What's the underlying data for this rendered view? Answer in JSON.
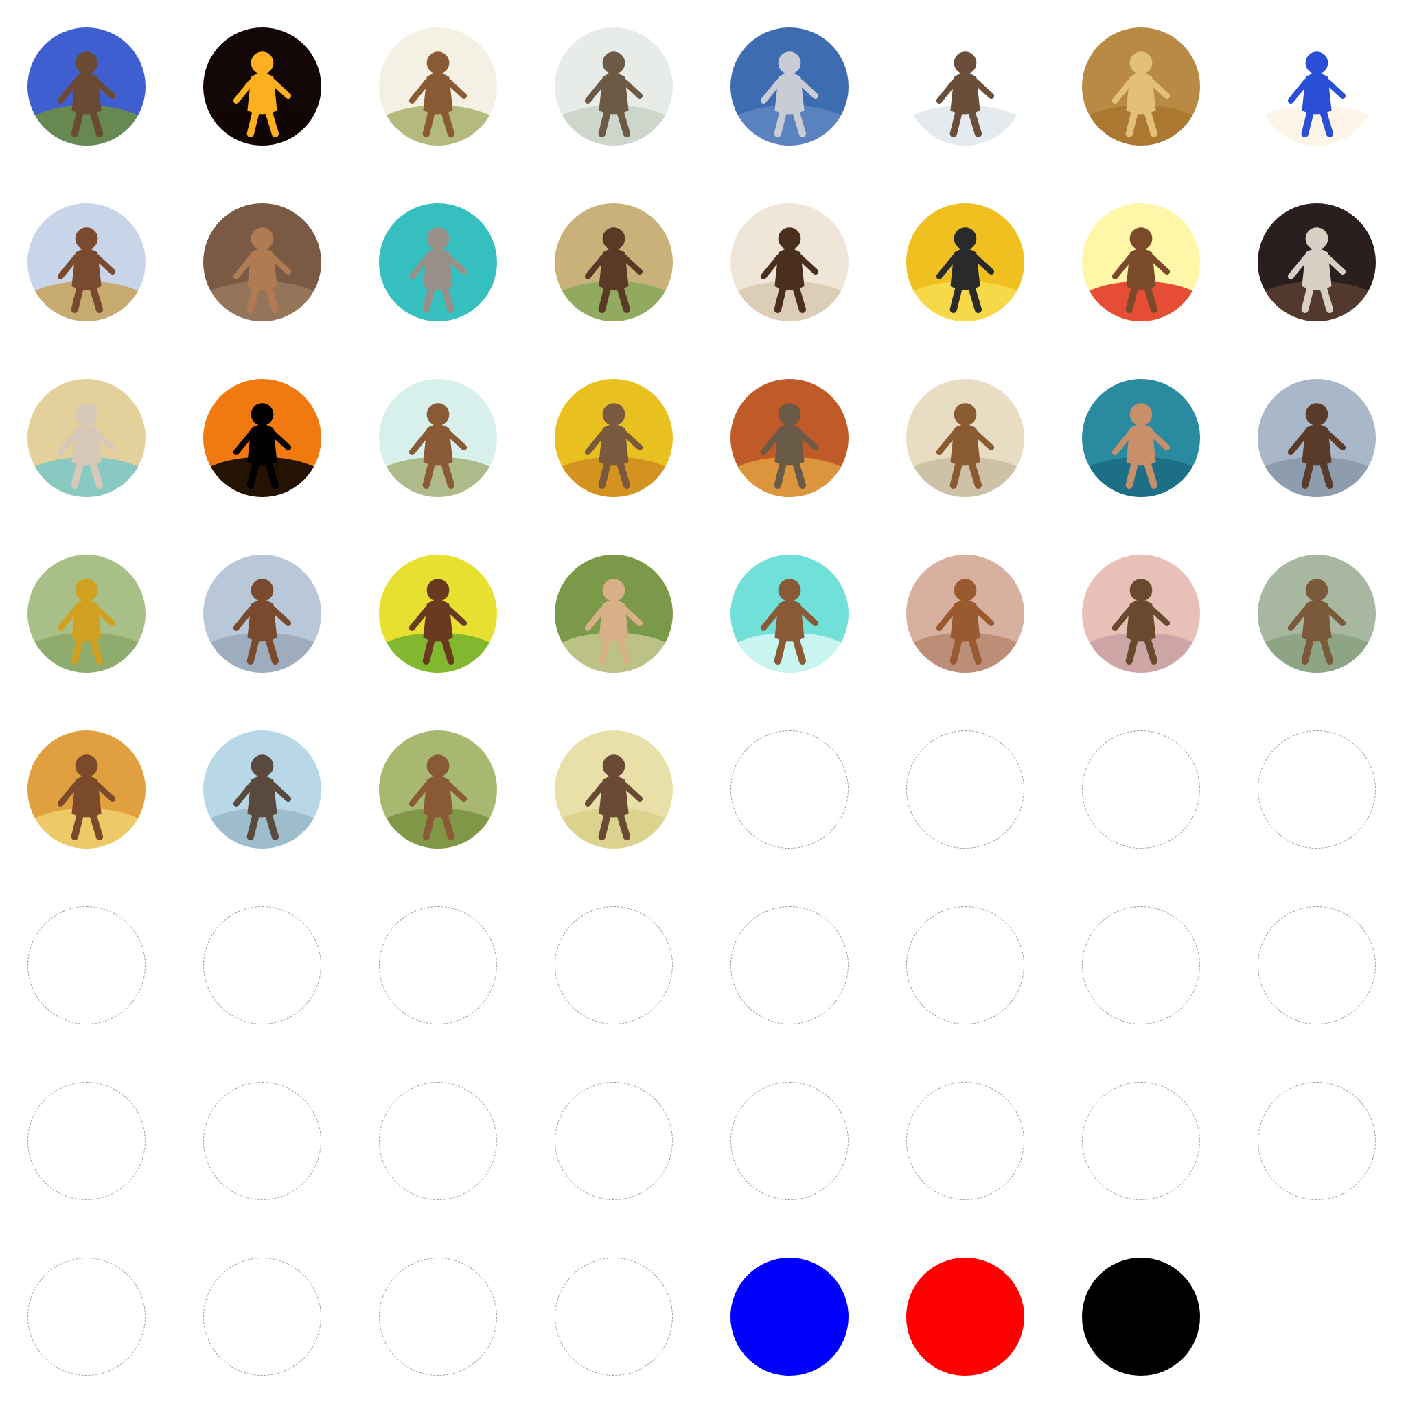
{
  "sprite_sheet": {
    "columns": 8,
    "rows": 8,
    "background": "#ffffff",
    "empty_outline_color": "#9a9a9a",
    "tokens": [
      {
        "icon": "caveman-crouching-icon",
        "bg": "#3f5fd0",
        "ground": "#6f8f3a",
        "figure": "#6b4a33"
      },
      {
        "icon": "torch-fire-icon",
        "bg": "#120606",
        "ground": "#120606",
        "figure": "#ffb020"
      },
      {
        "icon": "cavemen-with-clubs-icon",
        "bg": "#f4f1e4",
        "ground": "#a8b06a",
        "figure": "#8a5a35"
      },
      {
        "icon": "hunters-with-horse-icon",
        "bg": "#e8ece8",
        "ground": "#c9d2c6",
        "figure": "#6d5a45"
      },
      {
        "icon": "bearded-elder-with-staff-icon",
        "bg": "#3d6cb0",
        "ground": "#5f86c2",
        "figure": "#c9ccd4"
      },
      {
        "icon": "spear-thrower-icon",
        "bg": "#ffffff",
        "ground": "#dfe6ea",
        "figure": "#6b4e3a"
      },
      {
        "icon": "desert-scene-icon",
        "bg": "#b98a44",
        "ground": "#a8742f",
        "figure": "#e3c07a"
      },
      {
        "icon": "archer-in-blue-icon",
        "bg": "#ffffff",
        "ground": "#fdf3e4",
        "figure": "#2a4fd6"
      },
      {
        "icon": "hunter-with-bow-icon",
        "bg": "#c8d4e8",
        "ground": "#c6a25a",
        "figure": "#7a4a2f"
      },
      {
        "icon": "seated-caveman-icon",
        "bg": "#7a5a45",
        "ground": "#9a7a5e",
        "figure": "#b07a52"
      },
      {
        "icon": "meditating-sage-icon",
        "bg": "#36bfbf",
        "ground": "#36bfbf",
        "figure": "#9a8f88"
      },
      {
        "icon": "hominid-profile-icon",
        "bg": "#c8b27a",
        "ground": "#88a85a",
        "figure": "#5a3a26"
      },
      {
        "icon": "hairy-caveman-with-spear-icon",
        "bg": "#efe6d8",
        "ground": "#d8c8b0",
        "figure": "#4a2e1e"
      },
      {
        "icon": "walking-chimp-icon",
        "bg": "#f0c020",
        "ground": "#f6dd50",
        "figure": "#2a2a2a"
      },
      {
        "icon": "upright-hominid-rays-icon",
        "bg": "#fff6a8",
        "ground": "#e03020",
        "figure": "#7a4a2a"
      },
      {
        "icon": "bearded-man-dark-icon",
        "bg": "#2a1e1e",
        "ground": "#5a3e30",
        "figure": "#d8d0c4"
      },
      {
        "icon": "painted-face-woman-icon",
        "bg": "#e4d09a",
        "ground": "#7ac8c8",
        "figure": "#d8c8b8"
      },
      {
        "icon": "silhouette-fire-orb-icon",
        "bg": "#f07a10",
        "ground": "#000000",
        "figure": "#000000"
      },
      {
        "icon": "fur-clad-hunter-icon",
        "bg": "#d8f0ec",
        "ground": "#a8b07a",
        "figure": "#8a5a36"
      },
      {
        "icon": "rock-lifter-icon",
        "bg": "#e8c020",
        "ground": "#d08a20",
        "figure": "#7a5a3e"
      },
      {
        "icon": "ogre-with-club-icon",
        "bg": "#c05a28",
        "ground": "#e0a040",
        "figure": "#6a5a48"
      },
      {
        "icon": "yelling-caveman-icon",
        "bg": "#e8dcc2",
        "ground": "#c8bca2",
        "figure": "#8a5a30"
      },
      {
        "icon": "bare-chested-warrior-icon",
        "bg": "#2a8aa0",
        "ground": "#1a6a80",
        "figure": "#c8906a"
      },
      {
        "icon": "caveman-with-spear-icon",
        "bg": "#a8b8c8",
        "ground": "#8898a8",
        "figure": "#5a3a28"
      },
      {
        "icon": "leaping-ape-man-icon",
        "bg": "#a8c088",
        "ground": "#8aa868",
        "figure": "#d0a020"
      },
      {
        "icon": "club-swinger-icon",
        "bg": "#b8c8d8",
        "ground": "#98a8b8",
        "figure": "#7a4a2e"
      },
      {
        "icon": "caveman-raising-club-icon",
        "bg": "#e8e030",
        "ground": "#70b030",
        "figure": "#6a3a20"
      },
      {
        "icon": "crouching-tool-maker-icon",
        "bg": "#7a9a4a",
        "ground": "#c8c890",
        "figure": "#d8b088"
      },
      {
        "icon": "caveman-with-stick-icon",
        "bg": "#70e0d8",
        "ground": "#d8f8f4",
        "figure": "#8a5a36"
      },
      {
        "icon": "club-raiser-spotted-icon",
        "bg": "#d8b0a0",
        "ground": "#b88870",
        "figure": "#9a5a30"
      },
      {
        "icon": "archer-pink-icon",
        "bg": "#e8c0b8",
        "ground": "#c8a0a0",
        "figure": "#6a4a2e"
      },
      {
        "icon": "caveman-with-staff-star-icon",
        "bg": "#a8b8a0",
        "ground": "#88a080",
        "figure": "#7a5a3a"
      },
      {
        "icon": "wood-carrier-icon",
        "bg": "#e0a040",
        "ground": "#f0d070",
        "figure": "#7a4a2a"
      },
      {
        "icon": "ape-face-icon",
        "bg": "#b8d8e8",
        "ground": "#98b8c8",
        "figure": "#5a4a3e"
      },
      {
        "icon": "hominid-family-icon",
        "bg": "#a8b870",
        "ground": "#789040",
        "figure": "#8a5a36"
      },
      {
        "icon": "woman-with-club-icon",
        "bg": "#e8e0a8",
        "ground": "#d8d088",
        "figure": "#6a4a34"
      },
      {
        "icon": "empty-slot"
      },
      {
        "icon": "empty-slot"
      },
      {
        "icon": "empty-slot"
      },
      {
        "icon": "empty-slot"
      },
      {
        "icon": "empty-slot"
      },
      {
        "icon": "empty-slot"
      },
      {
        "icon": "empty-slot"
      },
      {
        "icon": "empty-slot"
      },
      {
        "icon": "empty-slot"
      },
      {
        "icon": "empty-slot"
      },
      {
        "icon": "empty-slot"
      },
      {
        "icon": "empty-slot"
      },
      {
        "icon": "empty-slot"
      },
      {
        "icon": "empty-slot"
      },
      {
        "icon": "empty-slot"
      },
      {
        "icon": "empty-slot"
      },
      {
        "icon": "empty-slot"
      },
      {
        "icon": "empty-slot"
      },
      {
        "icon": "empty-slot"
      },
      {
        "icon": "empty-slot"
      },
      {
        "icon": "empty-slot"
      },
      {
        "icon": "empty-slot"
      },
      {
        "icon": "empty-slot"
      },
      {
        "icon": "empty-slot"
      },
      {
        "icon": "blue-player-token",
        "solid": "#0000ff"
      },
      {
        "icon": "red-player-token",
        "solid": "#ff0000"
      },
      {
        "icon": "black-player-token",
        "solid": "#000000"
      }
    ]
  }
}
